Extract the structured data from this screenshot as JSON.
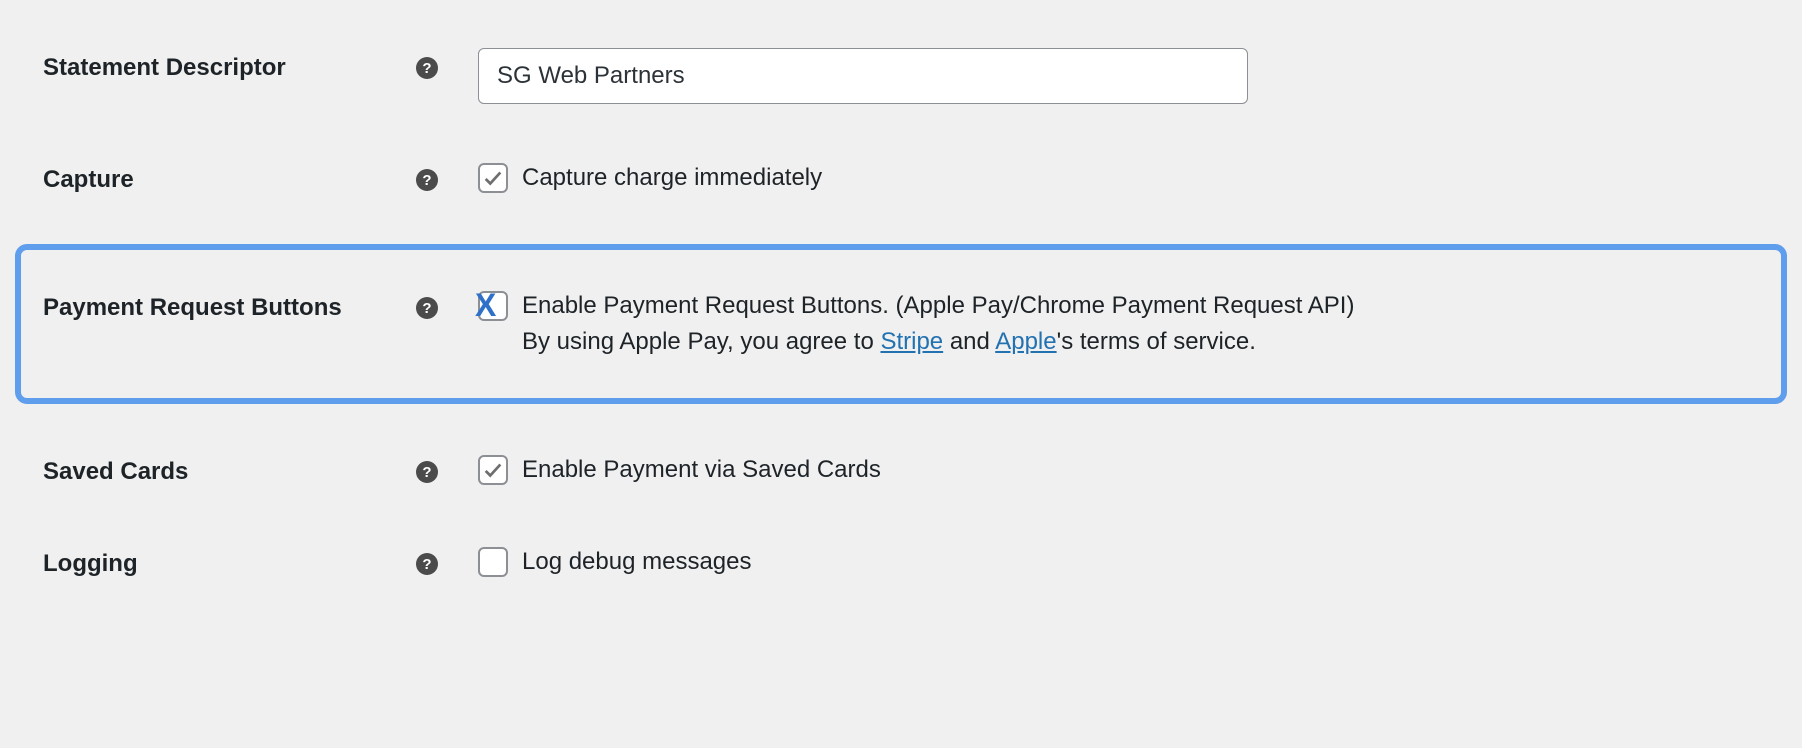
{
  "rows": {
    "statement_descriptor": {
      "label": "Statement Descriptor",
      "value": "SG Web Partners"
    },
    "capture": {
      "label": "Capture",
      "checkbox_label": "Capture charge immediately"
    },
    "payment_request_buttons": {
      "label": "Payment Request Buttons",
      "line1": "Enable Payment Request Buttons. (Apple Pay/Chrome Payment Request API)",
      "line2_prefix": "By using Apple Pay, you agree to ",
      "link_stripe": "Stripe",
      "line2_mid": " and ",
      "link_apple": "Apple",
      "line2_suffix": "'s terms of service."
    },
    "saved_cards": {
      "label": "Saved Cards",
      "checkbox_label": "Enable Payment via Saved Cards"
    },
    "logging": {
      "label": "Logging",
      "checkbox_label": "Log debug messages"
    }
  },
  "help_glyph": "?"
}
